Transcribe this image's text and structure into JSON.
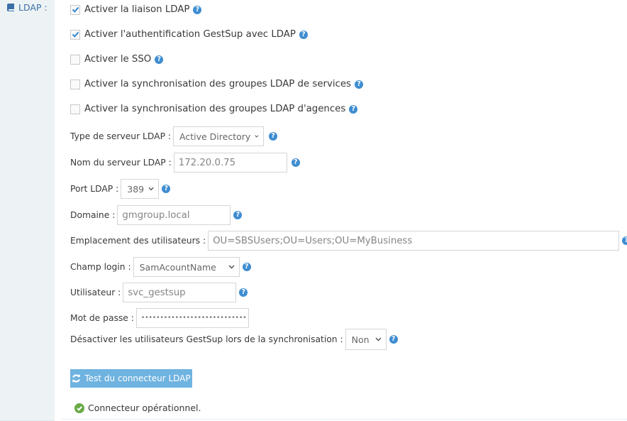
{
  "section": {
    "label": "LDAP :",
    "icon": "book-icon"
  },
  "checkboxes": [
    {
      "label": "Activer la liaison LDAP",
      "checked": true,
      "help": true
    },
    {
      "label": "Activer l'authentification GestSup avec LDAP",
      "checked": true,
      "help": true
    },
    {
      "label": "Activer le SSO",
      "checked": false,
      "help": true
    },
    {
      "label": "Activer la synchronisation des groupes LDAP de services",
      "checked": false,
      "help": true
    },
    {
      "label": "Activer la synchronisation des groupes LDAP d'agences",
      "checked": false,
      "help": true
    }
  ],
  "fields": {
    "server_type": {
      "label": "Type de serveur LDAP :",
      "value": "Active Directory"
    },
    "server_name": {
      "label": "Nom du serveur LDAP :",
      "value": "172.20.0.75"
    },
    "port": {
      "label": "Port LDAP :",
      "value": "389"
    },
    "domain": {
      "label": "Domaine :",
      "value": "gmgroup.local"
    },
    "users_location": {
      "label": "Emplacement des utilisateurs :",
      "value": "OU=SBSUsers;OU=Users;OU=MyBusiness"
    },
    "login_field": {
      "label": "Champ login :",
      "value": "SamAcountName"
    },
    "user": {
      "label": "Utilisateur :",
      "value": "svc_gestsup"
    },
    "password": {
      "label": "Mot de passe :",
      "value": "••••••••••••••••••••••••••••"
    },
    "disable_users": {
      "label": "Désactiver les utilisateurs GestSup lors de la synchronisation :",
      "value": "Non"
    }
  },
  "help_glyph": "?",
  "test_button": {
    "label": "Test du connecteur LDAP",
    "icon": "refresh-icon"
  },
  "status": {
    "text": "Connecteur opérationnel.",
    "icon": "check-circle-icon",
    "color": "#69aa46"
  },
  "colors": {
    "accent": "#3f8dd1",
    "button": "#6fb3e0",
    "sidebar": "#edf3f4",
    "label": "#3a6fa8"
  }
}
